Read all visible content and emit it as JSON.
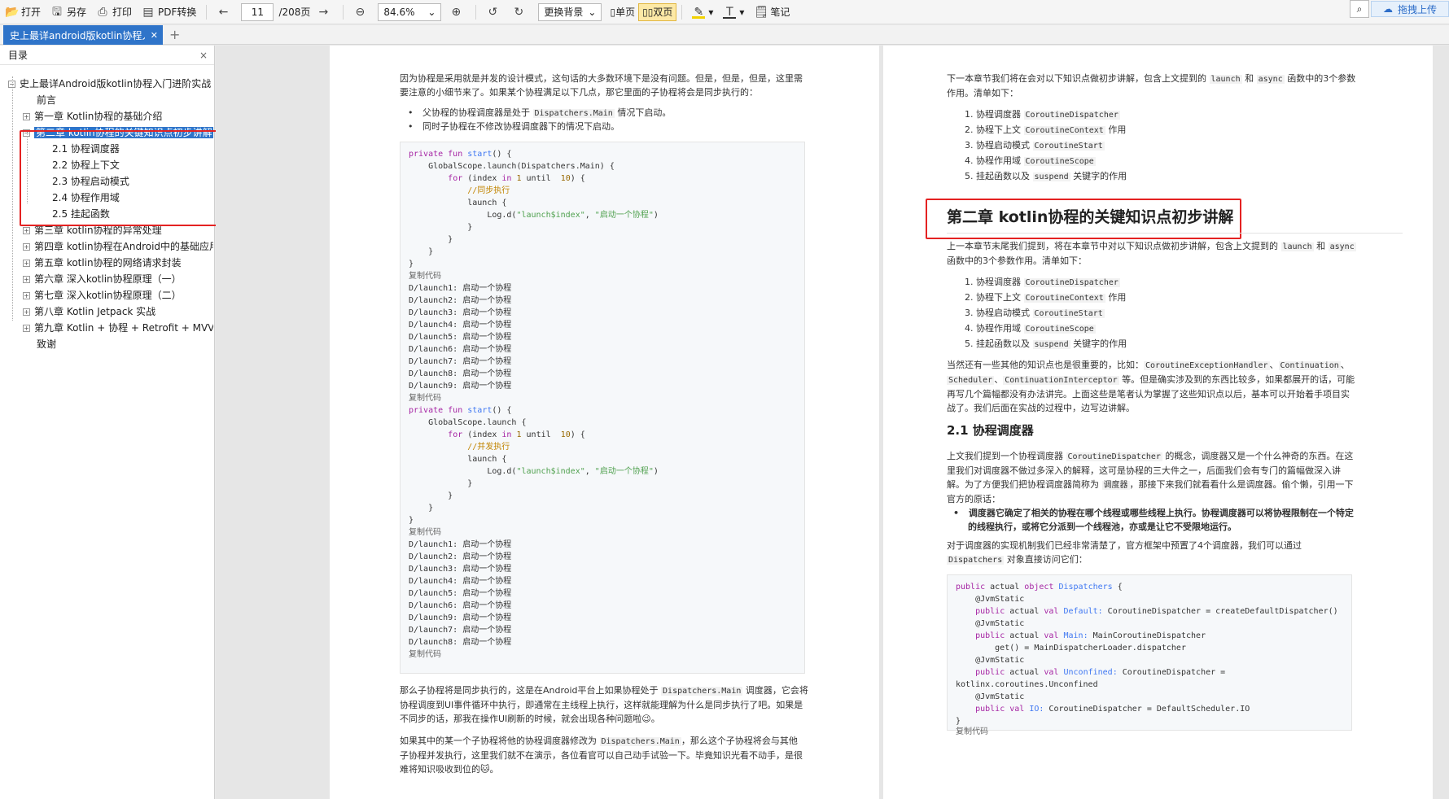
{
  "toolbar": {
    "open": "打开",
    "save_as": "另存",
    "print": "打印",
    "pdf_convert": "PDF转换",
    "page_current": "11",
    "page_total": "/208页",
    "zoom": "84.6%",
    "change_bg": "更换背景",
    "single_page": "单页",
    "double_page": "双页",
    "notes": "笔记",
    "drag_upload": "拖拽上传"
  },
  "tab": {
    "title": "史上最详android版kotlin协程入"
  },
  "sidebar": {
    "title": "目录",
    "items": [
      {
        "label": "史上最详Android版kotlin协程入门进阶实战"
      },
      {
        "label": "前言"
      },
      {
        "label": "第一章 Kotlin协程的基础介绍"
      },
      {
        "label": "第二章 kotlin协程的关键知识点初步讲解"
      },
      {
        "label": "2.1 协程调度器"
      },
      {
        "label": "2.2 协程上下文"
      },
      {
        "label": "2.3 协程启动模式"
      },
      {
        "label": "2.4 协程作用域"
      },
      {
        "label": "2.5 挂起函数"
      },
      {
        "label": "第三章 kotlin协程的异常处理"
      },
      {
        "label": "第四章 kotlin协程在Android中的基础应用"
      },
      {
        "label": "第五章 kotlin协程的网络请求封装"
      },
      {
        "label": "第六章 深入kotlin协程原理（一）"
      },
      {
        "label": "第七章 深入kotlin协程原理（二）"
      },
      {
        "label": "第八章 Kotlin Jetpack 实战"
      },
      {
        "label": "第九章 Kotlin + 协程 + Retrofit + MVVM"
      },
      {
        "label": "致谢"
      }
    ]
  },
  "page1": {
    "intro1": "因为协程是采用就是并发的设计模式，这句话的大多数环境下是没有问题。但是，但是，但是，这里需",
    "intro2": "要注意的小细节来了。如果某个协程满足以下几点，那它里面的子协程将会是同步执行的：",
    "bullet1_a": "父协程的协程调度器是处于 ",
    "bullet1_code": "Dispatchers.Main",
    "bullet1_b": " 情况下启动。",
    "bullet2": "同时子协程在不修改协程调度器下的情况下启动。",
    "copy_code": "复制代码",
    "outro1_a": "那么子协程将是同步执行的，这是在Android平台上如果协程处于 ",
    "outro1_code": "Dispatchers.Main",
    "outro1_b": " 调度器，它会将",
    "outro2": "协程调度到UI事件循环中执行，即通常在主线程上执行，这样就能理解为什么是同步执行了吧。如果是",
    "outro3": "不同步的话，那我在操作UI刷新的时候，就会出现各种问题啦😉。",
    "outro4_a": "如果其中的某一个子协程将他的协程调度器修改为 ",
    "outro4_code": "Dispatchers.Main",
    "outro4_b": "，那么这个子协程将会与其他",
    "outro5": "子协程并发执行，这里我们就不在演示，各位看官可以自己动手试验一下。毕竟知识光看不动手，是很",
    "outro6": "难将知识吸收到位的🐱。"
  },
  "page2": {
    "intro1_a": "下一本章节我们将在会对以下知识点做初步讲解，包含上文提到的 ",
    "intro1_c1": "launch",
    "intro1_b": " 和 ",
    "intro1_c2": "async",
    "intro1_c": " 函数中的3个参数",
    "intro2": "作用。清单如下：",
    "list": [
      {
        "num": "1.",
        "text": "协程调度器 ",
        "code": "CoroutineDispatcher",
        "tail": ""
      },
      {
        "num": "2.",
        "text": "协程下上文 ",
        "code": "CoroutineContext",
        "tail": " 作用"
      },
      {
        "num": "3.",
        "text": "协程启动模式 ",
        "code": "CoroutineStart",
        "tail": ""
      },
      {
        "num": "4.",
        "text": "协程作用域 ",
        "code": "CoroutineScope",
        "tail": ""
      },
      {
        "num": "5.",
        "text": "挂起函数以及 ",
        "code": "suspend",
        "tail": " 关键字的作用"
      }
    ],
    "chapter_title": "第二章 kotlin协程的关键知识点初步讲解",
    "p1_a": "上一本章节末尾我们提到，将在本章节中对以下知识点做初步讲解，包含上文提到的 ",
    "p1_c1": "launch",
    "p1_b": " 和 ",
    "p1_c2": "async",
    "p2": "函数中的3个参数作用。清单如下：",
    "list2": [
      {
        "num": "1.",
        "text": "协程调度器 ",
        "code": "CoroutineDispatcher",
        "tail": ""
      },
      {
        "num": "2.",
        "text": "协程下上文 ",
        "code": "CoroutineContext",
        "tail": " 作用"
      },
      {
        "num": "3.",
        "text": "协程启动模式 ",
        "code": "CoroutineStart",
        "tail": ""
      },
      {
        "num": "4.",
        "text": "协程作用域 ",
        "code": "CoroutineScope",
        "tail": ""
      },
      {
        "num": "5.",
        "text": "挂起函数以及 ",
        "code": "suspend",
        "tail": " 关键字的作用"
      }
    ],
    "p3_a": "当然还有一些其他的知识点也是很重要的，比如：",
    "p3_c1": "CoroutineExceptionHandler",
    "p3_sep": "、",
    "p3_c2": "Continuation",
    "p4_c1": "Scheduler",
    "p4_c2": "ContinuationInterceptor",
    "p4_b": " 等。但是确实涉及到的东西比较多，如果都展开的话，可能",
    "p5": "再写几个篇幅都没有办法讲完。上面这些是笔者认为掌握了这些知识点以后，基本可以开始着手项目实",
    "p6": "战了。我们后面在实战的过程中，边写边讲解。",
    "section_title": "2.1 协程调度器",
    "s1_a": "上文我们提到一个协程调度器 ",
    "s1_code": "CoroutineDispatcher",
    "s1_b": " 的概念，调度器又是一个什么神奇的东西。在这",
    "s2": "里我们对调度器不做过多深入的解释，这可是协程的三大件之一，后面我们会有专门的篇幅做深入讲",
    "s3_a": "解。为了方便我们把协程调度器简称为 ",
    "s3_code": "调度器",
    "s3_b": "，那接下来我们就看看什么是调度器。偷个懒，引用一下",
    "s4": "官方的原话：",
    "quote1": "调度器它确定了相关的协程在哪个线程或哪些线程上执行。协程调度器可以将协程限制在一个特定",
    "quote2": "的线程执行，或将它分派到一个线程池，亦或是让它不受限地运行。",
    "s5": "对于调度器的实现机制我们已经非常清楚了，官方框架中预置了4个调度器，我们可以通过",
    "s6_code": "Dispatchers",
    "s6_b": " 对象直接访问它们：",
    "copy_code": "复制代码"
  }
}
